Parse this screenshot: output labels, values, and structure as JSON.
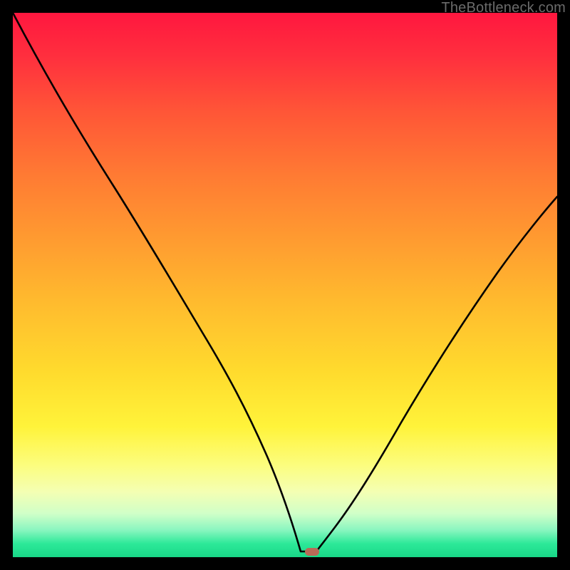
{
  "attribution": "TheBottleneck.com",
  "chart_data": {
    "type": "line",
    "title": "",
    "xlabel": "",
    "ylabel": "",
    "xlim": [
      0,
      100
    ],
    "ylim": [
      0,
      100
    ],
    "x": [
      0,
      5.2,
      10.5,
      15.7,
      20.9,
      26.2,
      31.4,
      36.6,
      41.9,
      44.5,
      47.1,
      49.7,
      52.4,
      53.7,
      55.6,
      57.9,
      60.2,
      65.4,
      70.7,
      75.9,
      81.2,
      86.4,
      91.6,
      96.9,
      100
    ],
    "y": [
      100,
      90.5,
      81.0,
      70.7,
      60.5,
      50.3,
      40.7,
      31.4,
      22.2,
      17.0,
      11.8,
      6.5,
      1.3,
      0.0,
      0.0,
      1.0,
      3.3,
      10.5,
      19.0,
      27.8,
      36.3,
      44.4,
      52.0,
      59.1,
      63.1
    ],
    "marker": {
      "x": 54.8,
      "y": 0.52
    },
    "series_color": "#000000",
    "gradient_stops": [
      {
        "pos": 0.0,
        "color": "#ff173f"
      },
      {
        "pos": 0.18,
        "color": "#ff5537"
      },
      {
        "pos": 0.42,
        "color": "#ff9c30"
      },
      {
        "pos": 0.66,
        "color": "#ffdb2d"
      },
      {
        "pos": 0.83,
        "color": "#fcfd7d"
      },
      {
        "pos": 0.92,
        "color": "#d0ffc8"
      },
      {
        "pos": 1.0,
        "color": "#18d787"
      }
    ]
  }
}
